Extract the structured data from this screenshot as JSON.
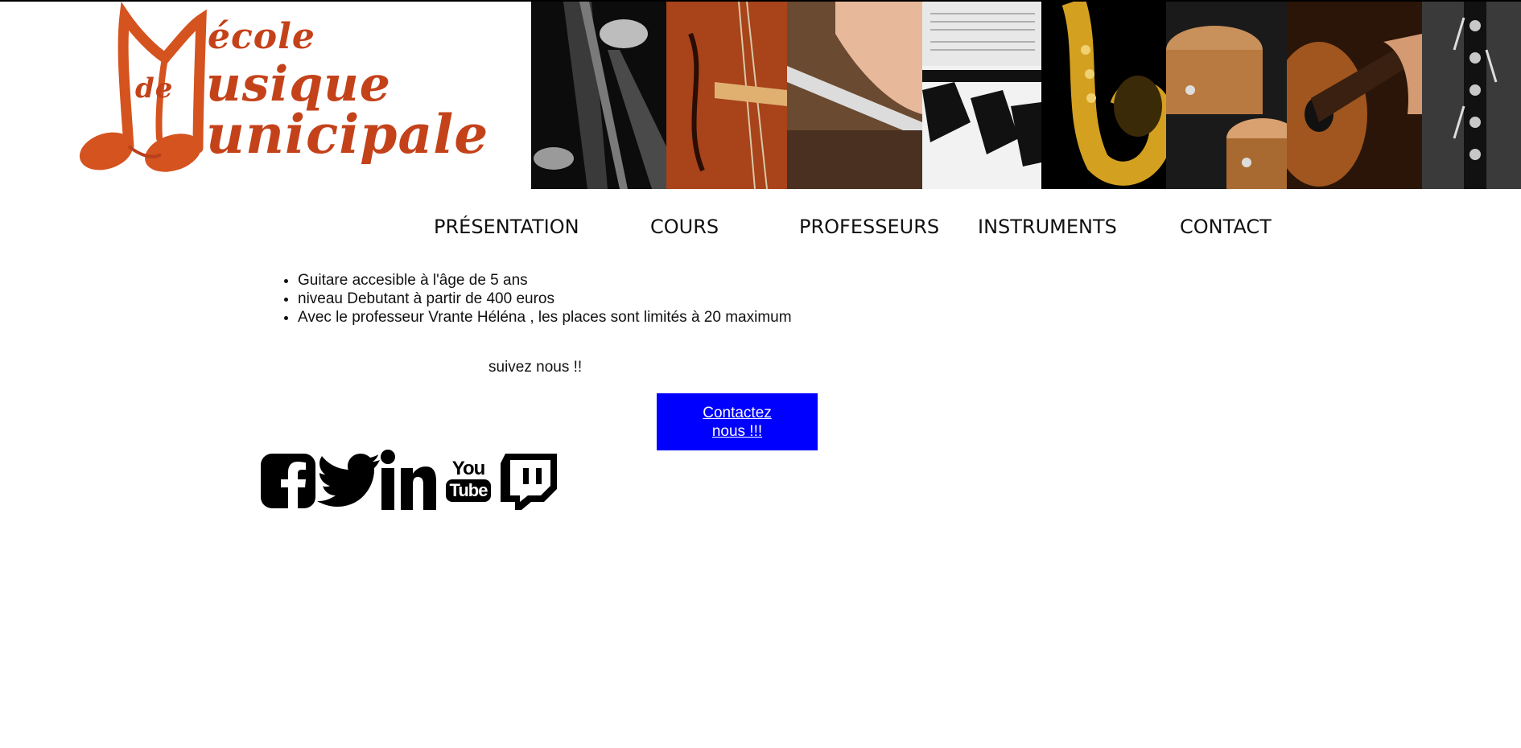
{
  "header": {
    "logo": {
      "word_ecole": "école",
      "word_de": "de",
      "word_usique": "usique",
      "word_unicipale": "unicipale",
      "brand_color": "#c4421a"
    },
    "banner_panels": [
      "double-bass",
      "violin",
      "flute",
      "piano",
      "saxophone",
      "drums",
      "guitar",
      "clarinet"
    ]
  },
  "nav": {
    "items": [
      "PRÉSENTATION",
      "COURS",
      "PROFESSEURS",
      "INSTRUMENTS",
      "CONTACT"
    ]
  },
  "main": {
    "bullets": [
      "Guitare accesible à l'âge de 5 ans",
      "niveau Debutant à partir de 400 euros",
      "Avec le professeur Vrante Héléna , les places sont limités à 20 maximum"
    ],
    "follow_text": "suivez nous !!",
    "contact_button": "Contactez nous !!!",
    "contact_button_color": "#0000ff"
  },
  "social": {
    "icons": [
      "facebook-icon",
      "twitter-icon",
      "linkedin-icon",
      "youtube-icon",
      "twitch-icon"
    ],
    "youtube_top": "You",
    "youtube_bottom": "Tube"
  }
}
